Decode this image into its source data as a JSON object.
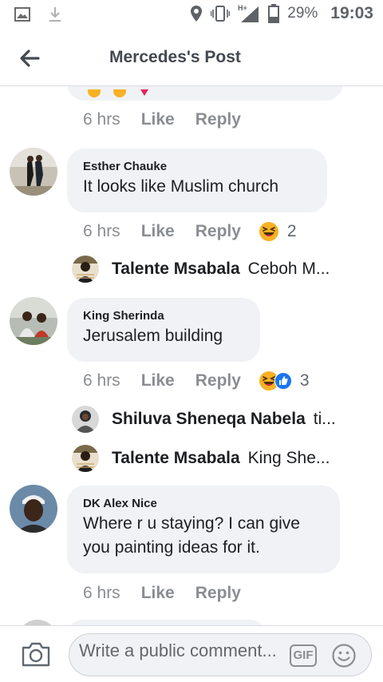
{
  "status_bar": {
    "battery": "29%",
    "time": "19:03"
  },
  "header": {
    "title": "Mercedes's Post"
  },
  "actions": {
    "like": "Like",
    "reply": "Reply"
  },
  "comments": [
    {
      "time": "6 hrs"
    },
    {
      "author": "Esther Chauke",
      "text": "It looks like Muslim church",
      "time": "6 hrs",
      "reaction_count": "2"
    },
    {
      "author": "King Sherinda",
      "text": "Jerusalem building",
      "time": "6 hrs",
      "reaction_count": "3"
    },
    {
      "author": "DK Alex Nice",
      "text_line1": "Where r u staying? I can give",
      "text_line2": "you painting ideas for it.",
      "time": "6 hrs"
    }
  ],
  "replies": [
    {
      "name": "Talente Msabala",
      "text": "Ceboh M..."
    },
    {
      "name": "Shiluva Sheneqa Nabela",
      "text": "ti..."
    },
    {
      "name": "Talente Msabala",
      "text": "King She..."
    }
  ],
  "composer": {
    "placeholder": "Write a public comment...",
    "gif_label": "GIF"
  },
  "colors": {
    "meta_gray": "#8a8d91",
    "bubble_bg": "#f0f2f5",
    "like_blue": "#1877f2",
    "haha_yellow": "#f7b125"
  },
  "icons": [
    "image-icon",
    "download-icon",
    "location-icon",
    "vibrate-icon",
    "signal-icon",
    "battery-icon",
    "back-arrow-icon",
    "camera-icon",
    "gif-icon",
    "emoji-icon",
    "haha-reaction-icon",
    "like-reaction-icon"
  ]
}
